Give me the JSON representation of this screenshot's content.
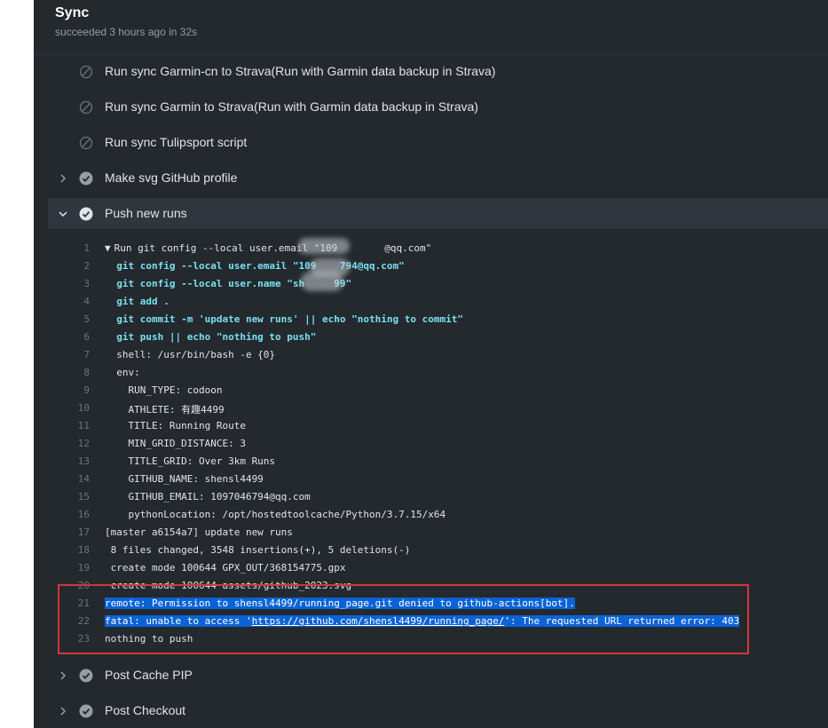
{
  "job": {
    "title": "Sync",
    "status": "succeeded 3 hours ago in 32s"
  },
  "steps": [
    {
      "label": "Run sync Garmin-cn to Strava(Run with Garmin data backup in Strava)",
      "icon": "skipped-icon",
      "chevron": false
    },
    {
      "label": "Run sync Garmin to Strava(Run with Garmin data backup in Strava)",
      "icon": "skipped-icon",
      "chevron": false
    },
    {
      "label": "Run sync Tulipsport script",
      "icon": "skipped-icon",
      "chevron": false
    },
    {
      "label": "Make svg GitHub profile",
      "icon": "check-circle-icon",
      "chevron": "right"
    },
    {
      "label": "Push new runs",
      "icon": "check-circle-icon",
      "chevron": "down"
    },
    {
      "label": "Post Cache PIP",
      "icon": "check-circle-icon",
      "chevron": "right"
    },
    {
      "label": "Post Checkout",
      "icon": "check-circle-icon",
      "chevron": "right"
    }
  ],
  "log": [
    {
      "n": "1",
      "text": "Run git config --local user.email \"109        @qq.com\"",
      "style": "normal",
      "caret": "▼"
    },
    {
      "n": "2",
      "text": "  git config --local user.email \"109    794@qq.com\"",
      "style": "cmd"
    },
    {
      "n": "3",
      "text": "  git config --local user.name \"sh     99\"",
      "style": "cmd"
    },
    {
      "n": "4",
      "text": "  git add .",
      "style": "cmd"
    },
    {
      "n": "5",
      "text": "  git commit -m 'update new runs' || echo \"nothing to commit\"",
      "style": "cmd"
    },
    {
      "n": "6",
      "text": "  git push || echo \"nothing to push\"",
      "style": "cmd"
    },
    {
      "n": "7",
      "text": "  shell: /usr/bin/bash -e {0}",
      "style": "normal"
    },
    {
      "n": "8",
      "text": "  env:",
      "style": "normal"
    },
    {
      "n": "9",
      "text": "    RUN_TYPE: codoon",
      "style": "normal"
    },
    {
      "n": "10",
      "text": "    ATHLETE: 有趣4499",
      "style": "normal"
    },
    {
      "n": "11",
      "text": "    TITLE: Running Route",
      "style": "normal"
    },
    {
      "n": "12",
      "text": "    MIN_GRID_DISTANCE: 3",
      "style": "normal"
    },
    {
      "n": "13",
      "text": "    TITLE_GRID: Over 3km Runs",
      "style": "normal"
    },
    {
      "n": "14",
      "text": "    GITHUB_NAME: shensl4499",
      "style": "normal"
    },
    {
      "n": "15",
      "text": "    GITHUB_EMAIL: 1097046794@qq.com",
      "style": "normal"
    },
    {
      "n": "16",
      "text": "    pythonLocation: /opt/hostedtoolcache/Python/3.7.15/x64",
      "style": "normal"
    },
    {
      "n": "17",
      "text": "[master a6154a7] update new runs",
      "style": "normal"
    },
    {
      "n": "18",
      "text": " 8 files changed, 3548 insertions(+), 5 deletions(-)",
      "style": "normal"
    },
    {
      "n": "19",
      "text": " create mode 100644 GPX_OUT/368154775.gpx",
      "style": "normal"
    },
    {
      "n": "20",
      "text": " create mode 100644 assets/github_2023.svg",
      "style": "normal"
    },
    {
      "n": "21",
      "text": "remote: Permission to shensl4499/running_page.git denied to github-actions[bot].",
      "style": "sel"
    },
    {
      "n": "22",
      "pre": "fatal: unable to access '",
      "link": "https://github.com/shensl4499/running_page/",
      "post": "': The requested URL returned error: 403",
      "style": "sel"
    },
    {
      "n": "23",
      "text": "nothing to push",
      "style": "normal"
    }
  ],
  "colors": {
    "panel_bg": "#24292e",
    "expanded_bg": "#2f363d",
    "command_text": "#79e0f0",
    "selection": "#0a63d6",
    "annotation_box": "#d7333b"
  }
}
